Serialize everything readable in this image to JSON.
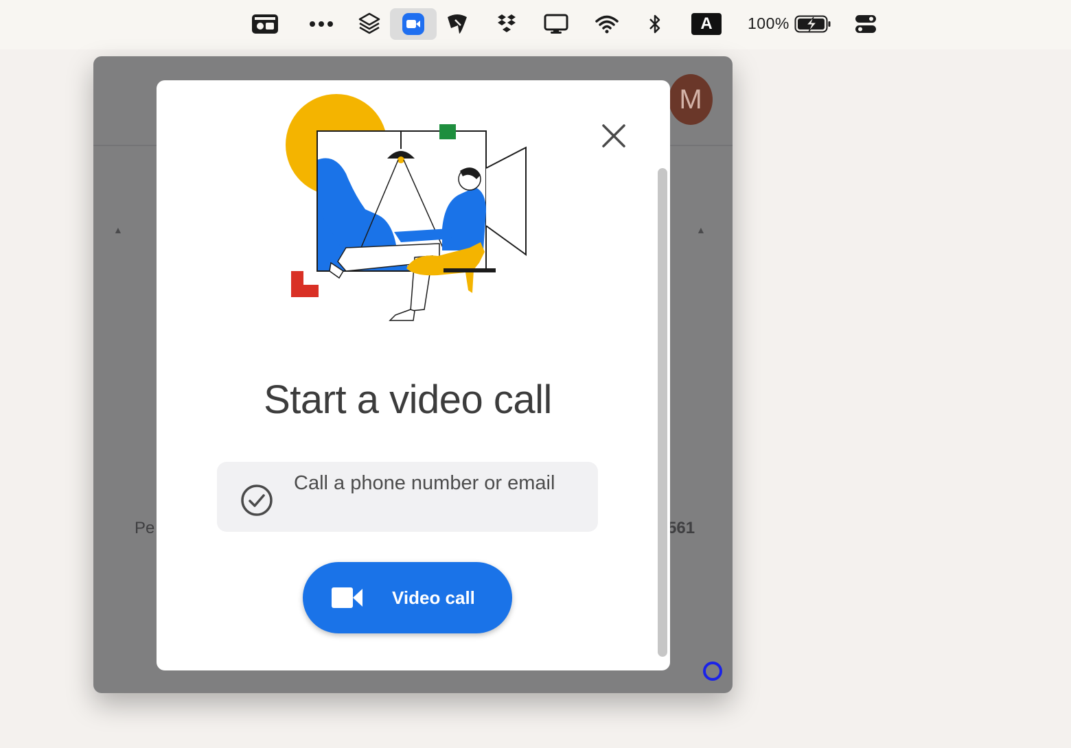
{
  "menubar": {
    "icons": [
      "screen-recorder-icon",
      "more-dots-icon",
      "layers-icon",
      "video-call-app-icon",
      "stylus-icon",
      "dropbox-icon",
      "display-icon",
      "wifi-icon",
      "bluetooth-icon",
      "keyboard-input-icon",
      "battery-charging-icon",
      "control-center-icon"
    ],
    "keyboard_letter": "A",
    "battery_percent": "100%"
  },
  "window": {
    "avatar_letter": "M",
    "bg_left_text": "Pe",
    "bg_right_text": "561"
  },
  "modal": {
    "title": "Start a video call",
    "option_label": "Call a phone number or email",
    "video_button_label": "Video call"
  },
  "colors": {
    "accent": "#1a73e8",
    "modal_bg": "#ffffff",
    "window_overlay": "#7f7f80"
  }
}
